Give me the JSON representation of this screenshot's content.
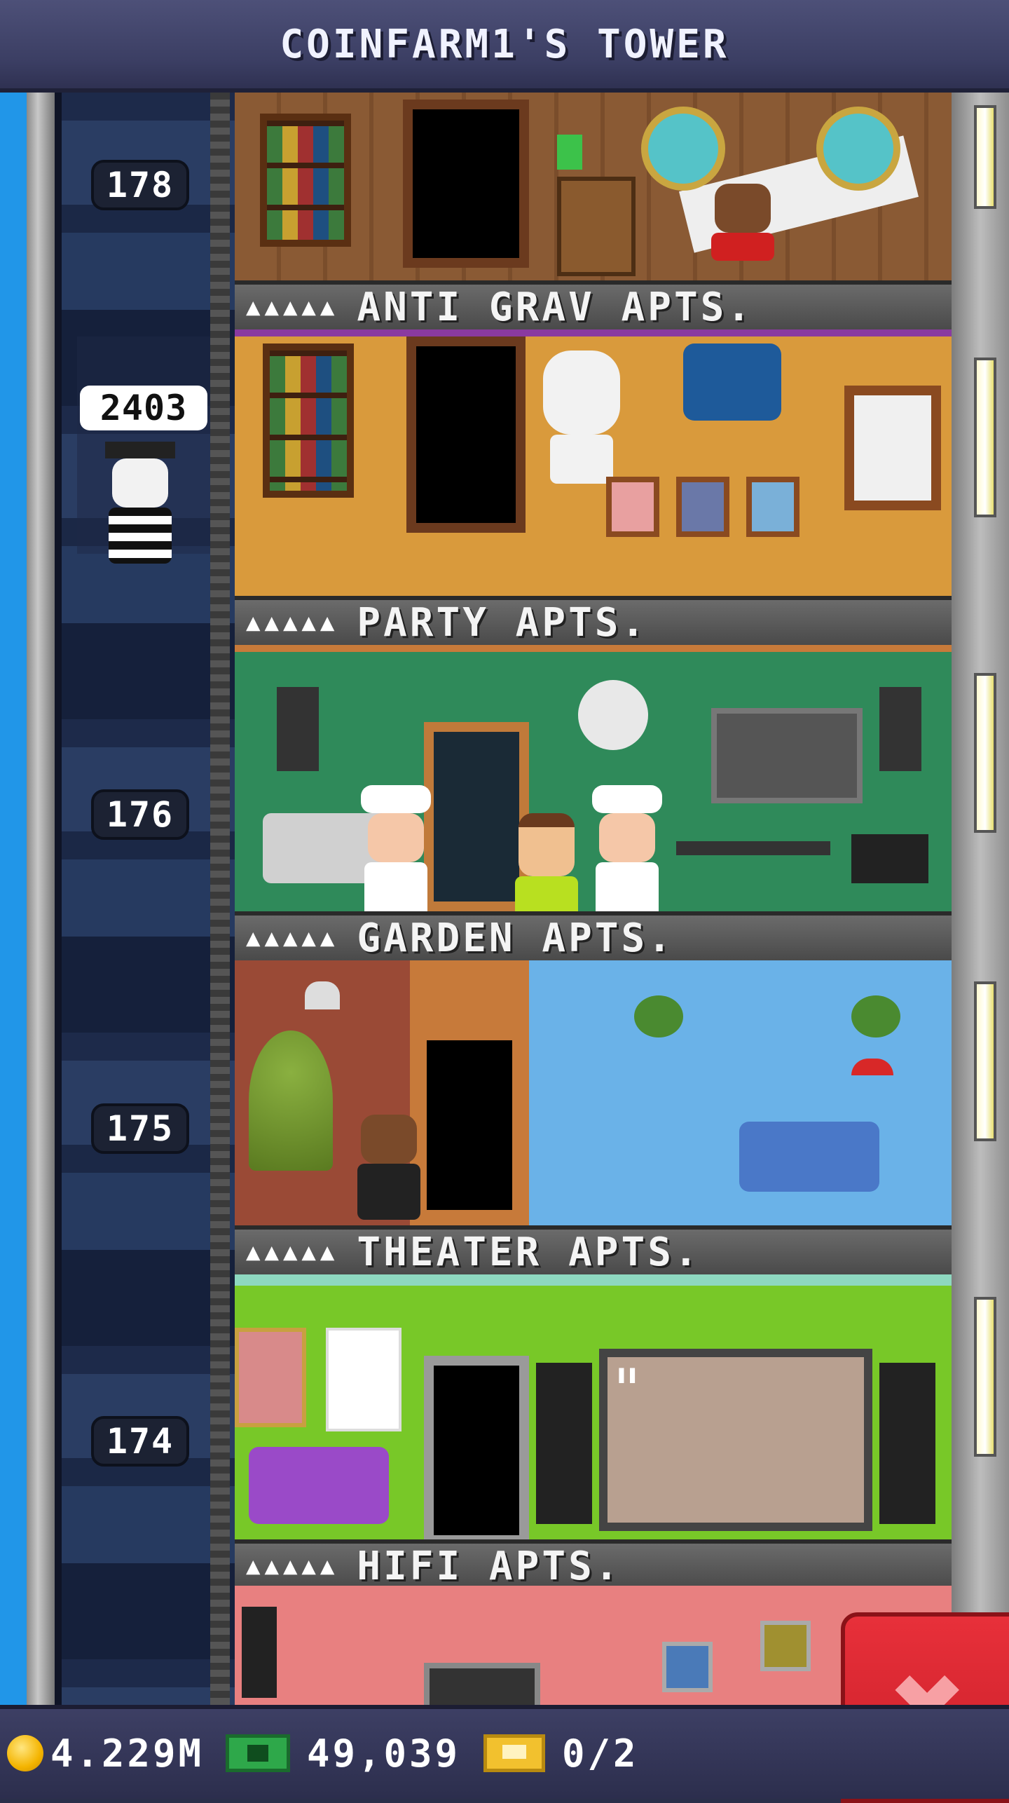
{
  "header": {
    "title": "COINFARM1'S TOWER"
  },
  "elevator": {
    "passenger_count": "2403"
  },
  "floors": [
    {
      "number": "178",
      "stars": "▲▲▲▲▲",
      "name": "ANTI GRAV APTS."
    },
    {
      "number": "",
      "stars": "▲▲▲▲▲",
      "name": "PARTY APTS."
    },
    {
      "number": "176",
      "stars": "▲▲▲▲▲",
      "name": "GARDEN APTS."
    },
    {
      "number": "175",
      "stars": "▲▲▲▲▲",
      "name": "THEATER APTS."
    },
    {
      "number": "174",
      "stars": "▲▲▲▲▲",
      "name": "HIFI APTS."
    }
  ],
  "status": {
    "coins": "4.229M",
    "bux": "49,039",
    "tickets": "0/2"
  },
  "close_button": {
    "label": "✖"
  },
  "colors": {
    "header_bg": "#3b3e63",
    "close_button": "#e8303a",
    "sky": "#2196e8"
  }
}
